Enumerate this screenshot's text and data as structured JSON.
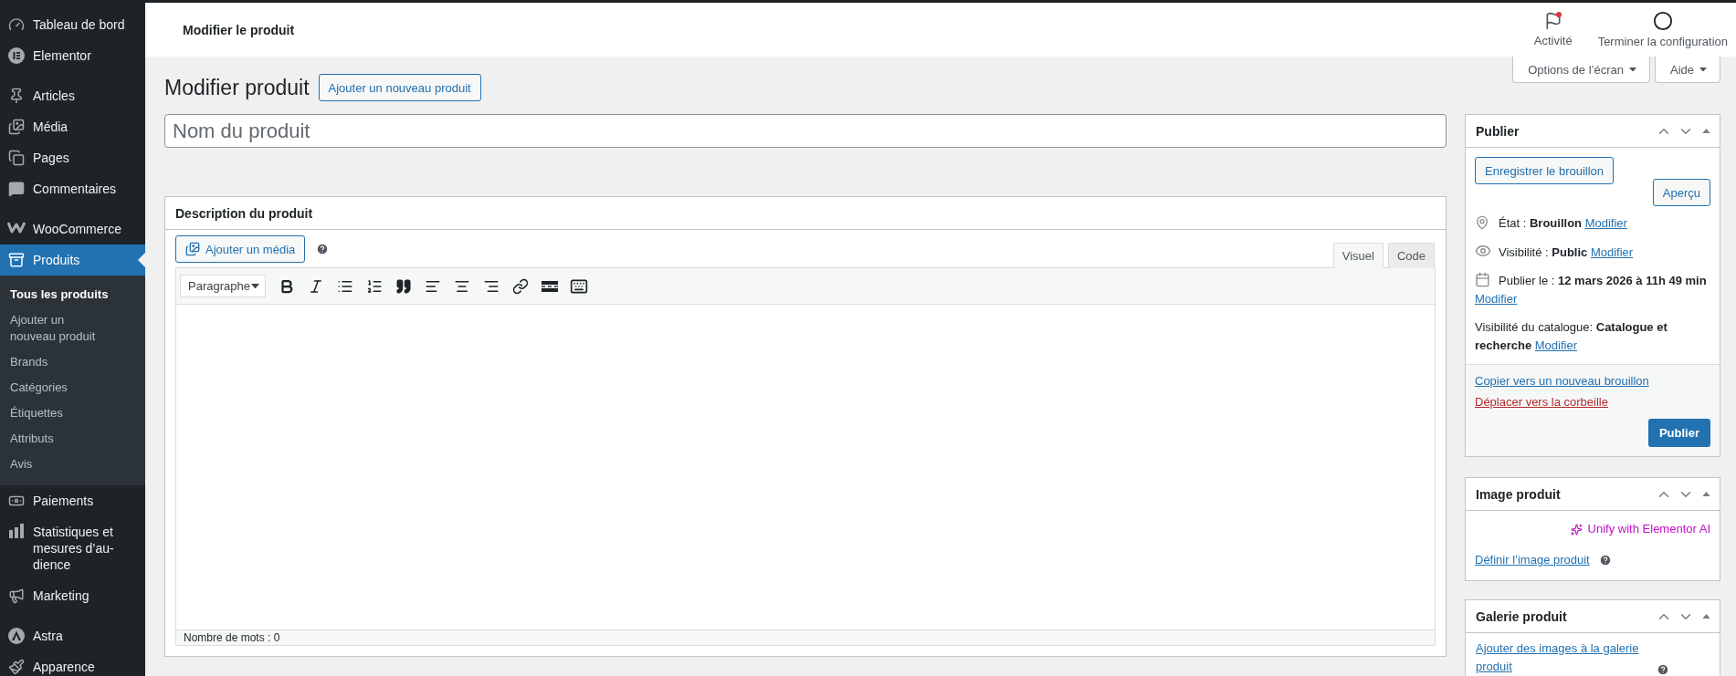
{
  "sidebar": {
    "groups": [
      [
        {
          "label": "Tableau de bord",
          "selected": false
        },
        {
          "label": "Elementor",
          "selected": false
        }
      ],
      [
        {
          "label": "Articles",
          "selected": false
        },
        {
          "label": "Média",
          "selected": false
        },
        {
          "label": "Pages",
          "selected": false
        },
        {
          "label": "Commentaires",
          "selected": false
        }
      ],
      [
        {
          "label": "WooCommerce",
          "selected": false
        },
        {
          "label": "Produits",
          "selected": true,
          "children": [
            {
              "label": "Tous les produits",
              "selected": true
            },
            {
              "label": "Ajouter un nouveau produit",
              "selected": false
            },
            {
              "label": "Brands",
              "selected": false
            },
            {
              "label": "Catégories",
              "selected": false
            },
            {
              "label": "Étiquettes",
              "selected": false
            },
            {
              "label": "Attributs",
              "selected": false
            },
            {
              "label": "Avis",
              "selected": false
            }
          ]
        },
        {
          "label": "Paiements",
          "selected": false
        },
        {
          "label": "Statistiques et mesures d’au-dience",
          "selected": false
        },
        {
          "label": "Marketing",
          "selected": false
        }
      ],
      [
        {
          "label": "Astra",
          "selected": false
        },
        {
          "label": "Apparence",
          "selected": false
        }
      ]
    ]
  },
  "header": {
    "title": "Modifier le produit",
    "actions": [
      {
        "label": "Activité",
        "notification": true
      },
      {
        "label": "Terminer la configuration",
        "notification": false
      }
    ]
  },
  "screen_tabs": [
    "Options de l’écran",
    "Aide"
  ],
  "page": {
    "heading": "Modifier produit",
    "add_button": "Ajouter un nouveau produit"
  },
  "title_field": {
    "placeholder": "Nom du produit"
  },
  "description": {
    "title": "Description du produit",
    "media_button": "Ajouter un média",
    "tabs": [
      {
        "label": "Visuel",
        "selected": true
      },
      {
        "label": "Code",
        "selected": false
      }
    ],
    "format": "Paragraphe",
    "word_count": "Nombre de mots : 0"
  },
  "publish": {
    "title": "Publier",
    "save_draft": "Enregistrer le brouillon",
    "preview": "Aperçu",
    "details": [
      {
        "kind": "status",
        "text": "État : **Brouillon**",
        "link": "Modifier"
      },
      {
        "kind": "visibility",
        "text": "Visibilité : **Public**",
        "link": "Modifier"
      },
      {
        "kind": "date",
        "text": "Publier le : **12 mars 2026 à 11h 49 min**",
        "link": "Modifier"
      },
      {
        "kind": "catalog",
        "text": "Visibilité du catalogue: **Catalogue et recherche**",
        "link": "Modifier"
      }
    ],
    "copy_link": "Copier vers un nouveau brouillon",
    "trash_link": "Déplacer vers la corbeille",
    "publish_button": "Publier"
  },
  "product_image": {
    "title": "Image produit",
    "ai_link": "Unify with Elementor AI",
    "set_link": "Définir l’image produit"
  },
  "gallery": {
    "title": "Galerie produit",
    "add_link": "Ajouter des images à la galerie produit"
  }
}
